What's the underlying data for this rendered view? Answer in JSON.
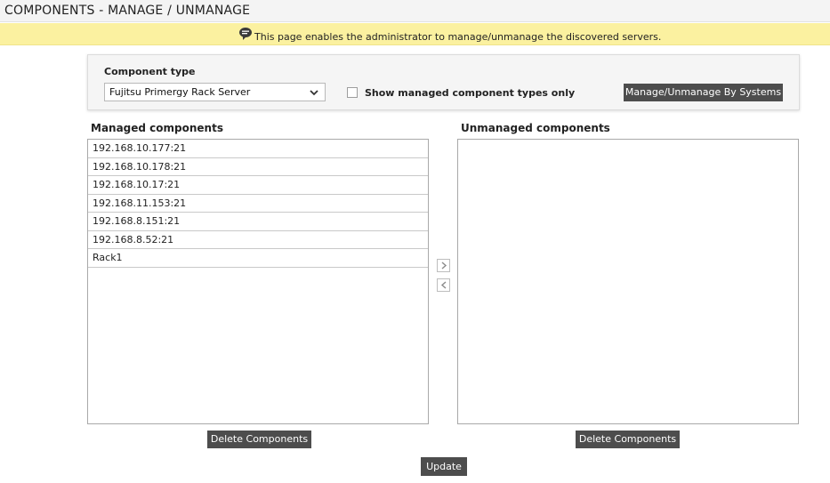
{
  "page": {
    "title": "COMPONENTS - MANAGE / UNMANAGE",
    "info_message": "This page enables the administrator to manage/unmanage the discovered servers."
  },
  "filter": {
    "component_type_label": "Component type",
    "component_type_value": "Fujitsu Primergy Rack Server",
    "show_managed_only_label": "Show managed component types only",
    "show_managed_only_checked": false,
    "manage_by_systems_label": "Manage/Unmanage By Systems"
  },
  "managed": {
    "title": "Managed components",
    "items": [
      "192.168.10.177:21",
      "192.168.10.178:21",
      "192.168.10.17:21",
      "192.168.11.153:21",
      "192.168.8.151:21",
      "192.168.8.52:21",
      "Rack1"
    ],
    "delete_label": "Delete Components"
  },
  "unmanaged": {
    "title": "Unmanaged components",
    "items": [],
    "delete_label": "Delete Components"
  },
  "actions": {
    "move_right_icon": "chevron-right-icon",
    "move_left_icon": "chevron-left-icon",
    "update_label": "Update"
  },
  "colors": {
    "banner": "#fbf1a0",
    "button": "#4d4d4d",
    "title_bar": "#f4f4f4"
  }
}
